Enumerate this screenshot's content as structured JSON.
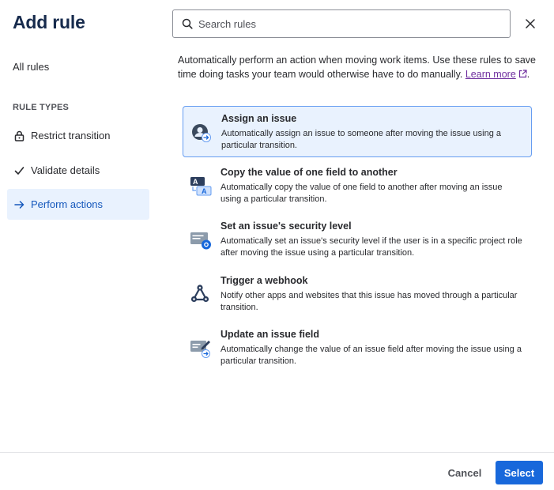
{
  "dialog": {
    "title": "Add rule"
  },
  "sidebar": {
    "all_rules_label": "All rules",
    "section_heading": "RULE TYPES",
    "items": [
      {
        "label": "Restrict transition",
        "icon": "lock-icon"
      },
      {
        "label": "Validate details",
        "icon": "check-icon"
      },
      {
        "label": "Perform actions",
        "icon": "arrow-right-icon",
        "selected": true
      }
    ]
  },
  "search": {
    "placeholder": "Search rules",
    "value": ""
  },
  "intro": {
    "text": "Automatically perform an action when moving work items. Use these rules to save time doing tasks your team would otherwise have to do manually.",
    "learn_more": "Learn more",
    "trailing": "."
  },
  "rules": [
    {
      "title": "Assign an issue",
      "description": "Automatically assign an issue to someone after moving the issue using a particular transition.",
      "icon": "assign-user-icon",
      "selected": true
    },
    {
      "title": "Copy the value of one field to another",
      "description": "Automatically copy the value of one field to another after moving an issue using a particular transition.",
      "icon": "copy-field-icon"
    },
    {
      "title": "Set an issue's security level",
      "description": "Automatically set an issue's security level if the user is in a specific project role after moving the issue using a particular transition.",
      "icon": "security-level-icon"
    },
    {
      "title": "Trigger a webhook",
      "description": "Notify other apps and websites that this issue has moved through a particular transition.",
      "icon": "webhook-icon"
    },
    {
      "title": "Update an issue field",
      "description": "Automatically change the value of an issue field after moving the issue using a particular transition.",
      "icon": "update-field-icon"
    }
  ],
  "footer": {
    "cancel_label": "Cancel",
    "select_label": "Select"
  },
  "colors": {
    "accent": "#1868db",
    "selected_bg": "#e9f2fe",
    "selected_border": "#669df1",
    "link_visited": "#6e2e9e"
  }
}
